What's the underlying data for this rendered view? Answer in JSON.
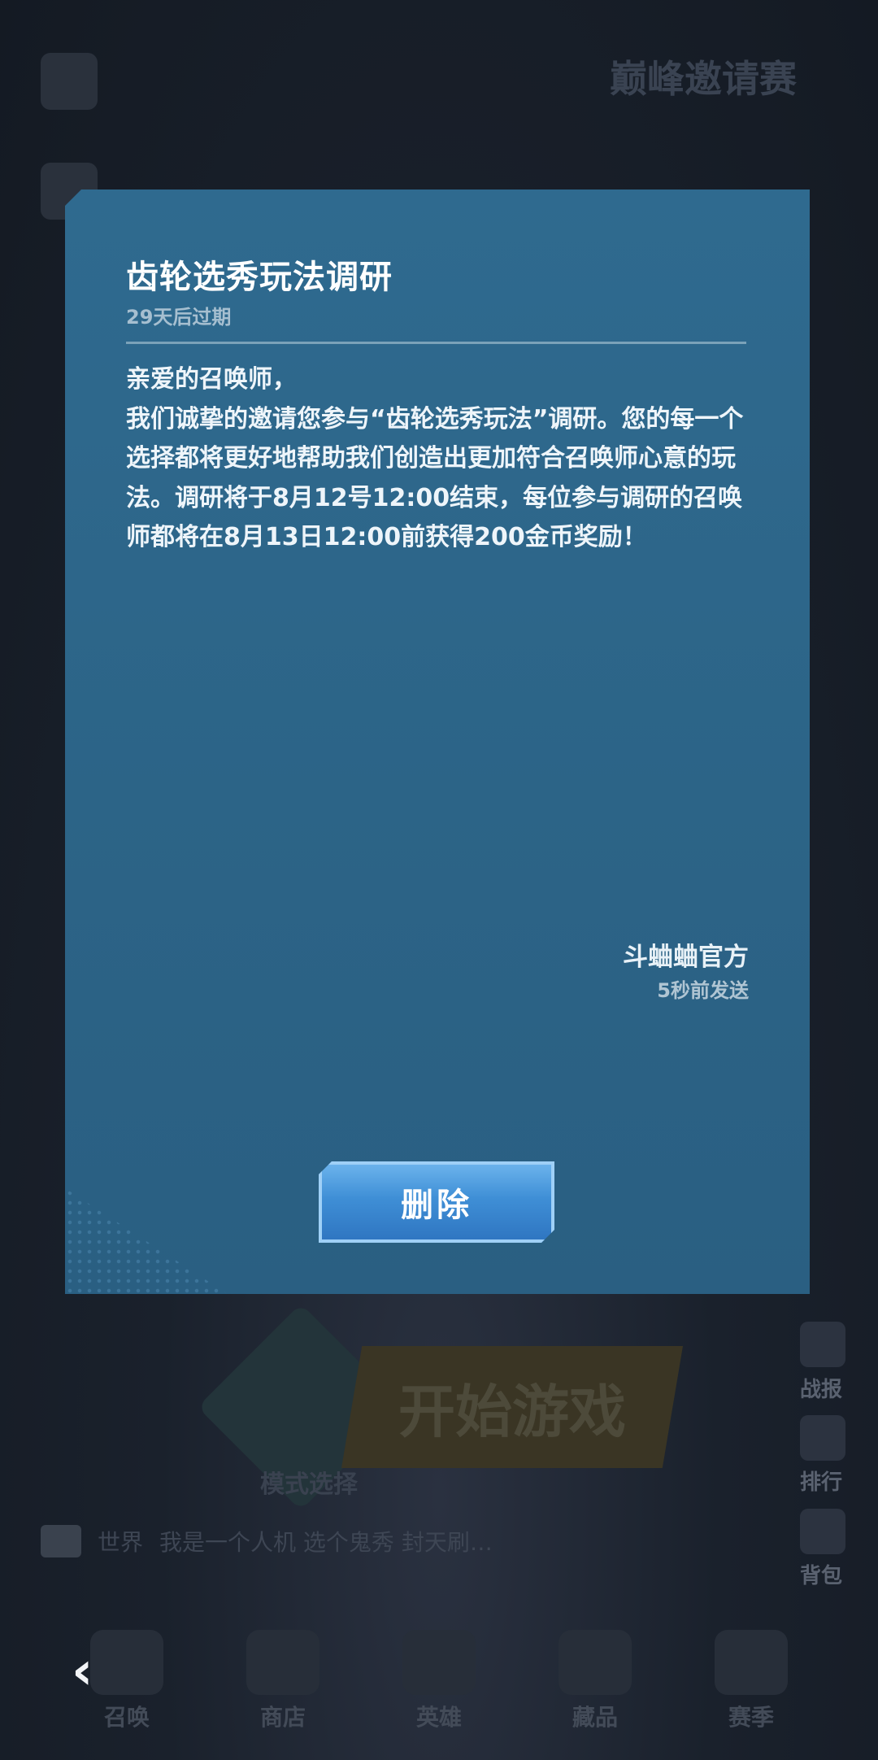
{
  "background": {
    "event_banner": "巅峰邀请赛",
    "start_game": "开始游戏",
    "mode_select": "模式选择",
    "chat_channel": "世界",
    "chat_message": "我是一个人机 选个鬼秀 封天刷…",
    "right_menu": [
      "战报",
      "排行",
      "背包"
    ],
    "bottom_nav": [
      "召唤",
      "商店",
      "英雄",
      "藏品",
      "赛季"
    ]
  },
  "mail": {
    "title": "齿轮选秀玩法调研",
    "expire": "29天后过期",
    "paragraphs": [
      "亲爱的召唤师，",
      "我们诚挚的邀请您参与“齿轮选秀玩法”调研。您的每一个选择都将更好地帮助我们创造出更加符合召唤师心意的玩法。调研将于8月12号12:00结束，每位参与调研的召唤师都将在8月13日12:00前获得200金币奖励！"
    ],
    "sender": "斗蛐蛐官方",
    "sent_time": "5秒前发送",
    "delete_label": "删除"
  },
  "back_icon": "chevron-left-icon"
}
